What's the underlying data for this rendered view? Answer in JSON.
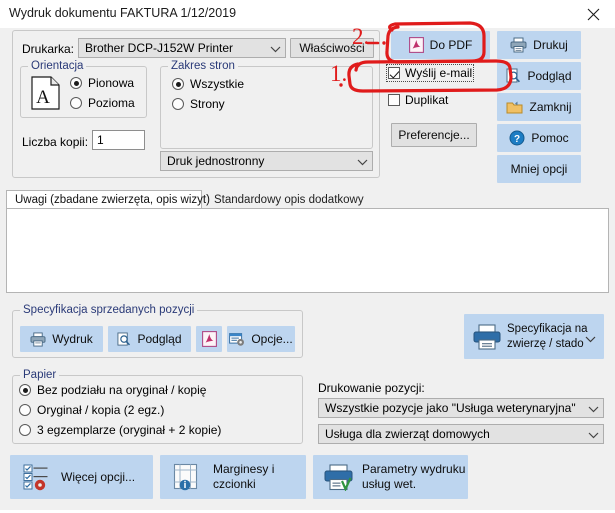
{
  "window": {
    "title": "Wydruk dokumentu FAKTURA 1/12/2019",
    "close_label": "close-icon"
  },
  "printer_row": {
    "label": "Drukarka:",
    "selected_printer": "Brother DCP-J152W Printer",
    "properties_button": "Właściwości"
  },
  "orientation": {
    "legend": "Orientacja",
    "options": [
      {
        "label": "Pionowa",
        "selected": true
      },
      {
        "label": "Pozioma",
        "selected": false
      }
    ],
    "preview_letter": "A"
  },
  "copies": {
    "label": "Liczba kopii:",
    "value": "1"
  },
  "page_range": {
    "legend": "Zakres stron",
    "options": [
      {
        "label": "Wszystkie",
        "selected": true
      },
      {
        "label": "Strony",
        "selected": false
      }
    ]
  },
  "duplex_combo": {
    "value": "Druk jednostronny"
  },
  "action_buttons": {
    "to_pdf": "Do PDF",
    "print": "Drukuj",
    "preview": "Podgląd",
    "close": "Zamknij",
    "help": "Pomoc",
    "less_options": "Mniej opcji",
    "preferences": "Preferencje..."
  },
  "checkboxes": {
    "send_email": {
      "label": "Wyślij e-mail",
      "checked": true
    },
    "duplicate": {
      "label": "Duplikat",
      "checked": false
    }
  },
  "tabs": [
    {
      "label": "Uwagi (zbadane zwierzęta, opis wizyt)",
      "active": true
    },
    {
      "label": "Standardowy opis dodatkowy",
      "active": false
    }
  ],
  "notes": {
    "value": ""
  },
  "sold_items": {
    "legend": "Specyfikacja sprzedanych pozycji",
    "buttons": [
      {
        "label": "Wydruk",
        "icon": "printer-icon"
      },
      {
        "label": "Podgląd",
        "icon": "preview-magnifier-icon"
      },
      {
        "label": "",
        "icon": "pdf-icon"
      },
      {
        "label": "Opcje...",
        "icon": "options-gear-icon"
      }
    ]
  },
  "animal_spec_button": {
    "line1": "Specyfikacja na",
    "line2": "zwierzę / stado",
    "icon": "printer-icon",
    "arrow": "chevron-down-icon"
  },
  "paper": {
    "legend": "Papier",
    "options": [
      {
        "label": "Bez podziału na oryginał / kopię",
        "selected": true
      },
      {
        "label": "Oryginał / kopia (2 egz.)",
        "selected": false
      },
      {
        "label": "3 egzemplarze (oryginał + 2 kopie)",
        "selected": false
      }
    ]
  },
  "position_printing": {
    "label": "Drukowanie pozycji:",
    "combo1_value": "Wszystkie pozycje jako \"Usługa weterynaryjna\"",
    "combo2_value": "Usługa dla zwierząt domowych"
  },
  "bottom_buttons": [
    {
      "line1": "Więcej opcji...",
      "line2": "",
      "icon": "checklist-gear-icon"
    },
    {
      "line1": "Marginesy i",
      "line2": "czcionki",
      "icon": "margins-info-icon"
    },
    {
      "line1": "Parametry wydruku",
      "line2": "usług wet.",
      "icon": "printer-check-icon"
    }
  ],
  "annotations": [
    {
      "label": "1.",
      "target": "wyslij-email-checkbox"
    },
    {
      "label": "2.",
      "target": "do-pdf-button"
    }
  ],
  "colors": {
    "button_blue": "#bdd5ef",
    "dialog_gray": "#f0f0f0",
    "legend_blue": "#2a3a78",
    "annotation_red": "#e01b1b"
  }
}
